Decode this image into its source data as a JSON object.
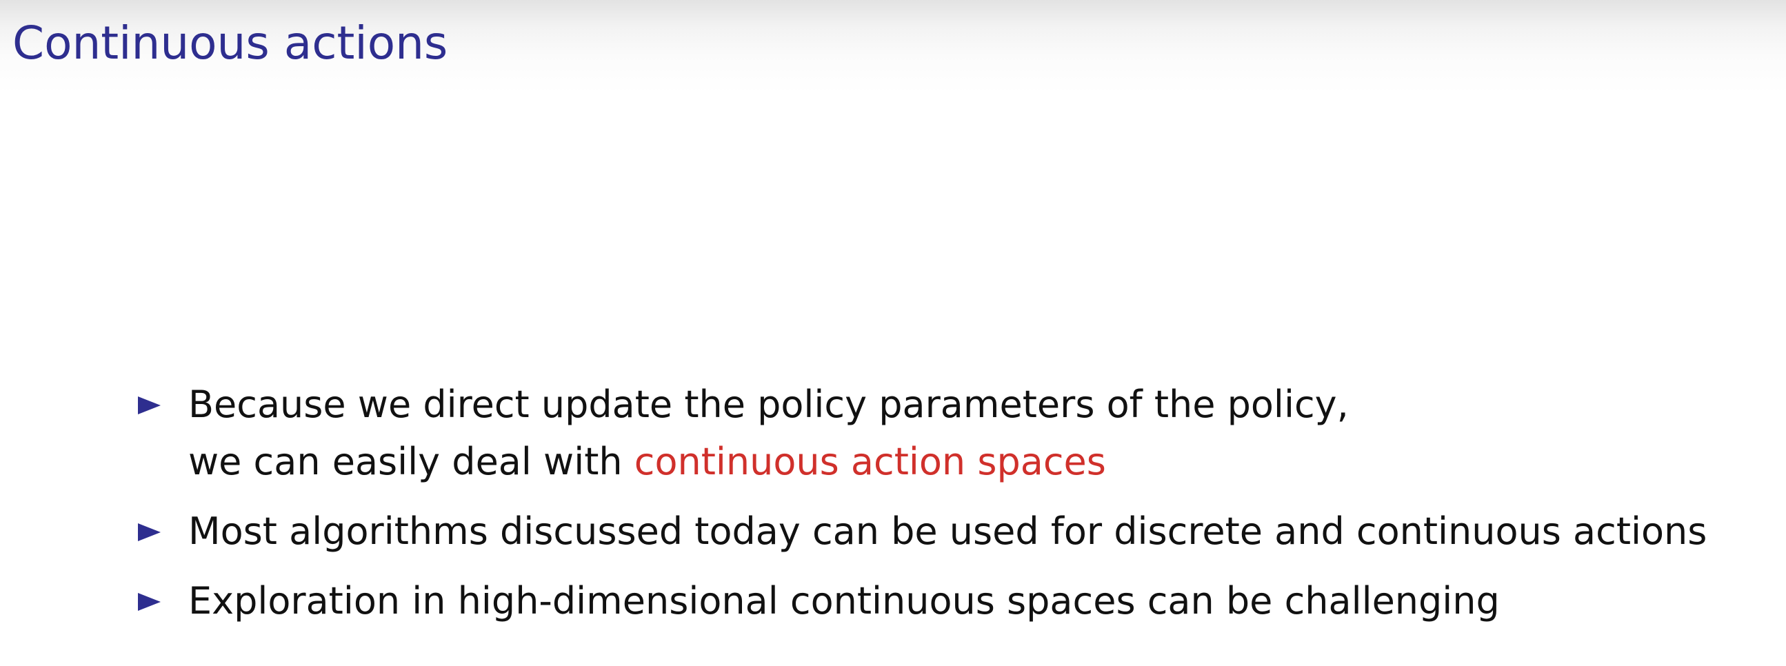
{
  "slide": {
    "title": "Continuous actions",
    "accent_color": "#2e2e8f",
    "highlight_color": "#d0302b",
    "bullet_marker_icon": "triangle-right-icon",
    "bullets": [
      {
        "line1": "Because we direct update the policy parameters of the policy,",
        "line2_prefix": "we can easily deal with ",
        "line2_highlight": "continuous action spaces"
      },
      {
        "text": "Most algorithms discussed today can be used for discrete and continuous actions"
      },
      {
        "text": "Exploration in high-dimensional continuous spaces can be challenging"
      }
    ]
  }
}
